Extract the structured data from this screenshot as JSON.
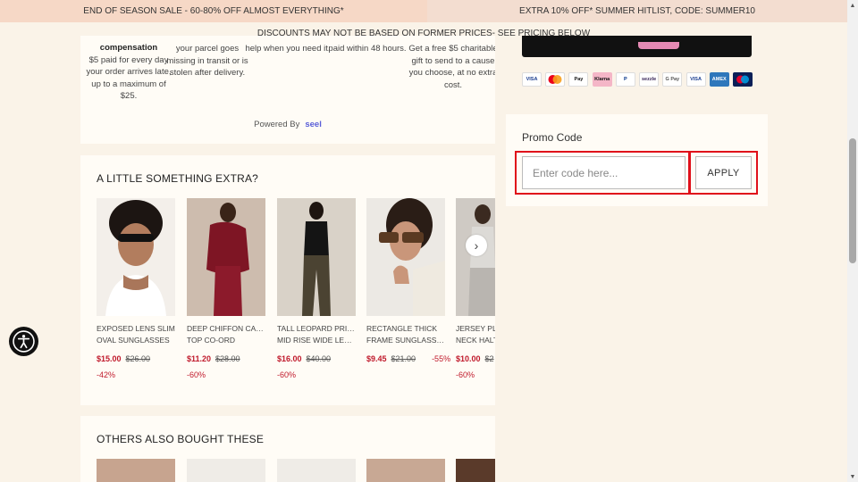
{
  "banner": {
    "left_text": "END OF SEASON SALE - 60-80% OFF ALMOST EVERYTHING*",
    "right_text": "EXTRA 10% OFF* SUMMER HITLIST, CODE: SUMMER10",
    "disclaimer": "DISCOUNTS MAY NOT BE BASED ON FORMER PRICES- SEE PRICING BELOW"
  },
  "benefits": [
    {
      "title": "compensation",
      "text": "$5 paid for every day your order arrives late, up to a maximum of $25."
    },
    {
      "title": "",
      "text": "your parcel goes missing in transit or is stolen after delivery."
    },
    {
      "title": "",
      "text": "help when you need it."
    },
    {
      "title": "",
      "text": "paid within 48 hours."
    },
    {
      "title": "",
      "text": "Get a free $5 charitable gift to send to a cause you choose, at no extra cost."
    }
  ],
  "powered": {
    "label": "Powered By",
    "brand": "seel"
  },
  "extra_section": {
    "title": "A LITTLE SOMETHING EXTRA?",
    "products": [
      {
        "name_line1": "EXPOSED LENS SLIM",
        "name_line2": "OVAL SUNGLASSES",
        "price": "$15.00",
        "old_price": "$26.00",
        "discount": "-42%"
      },
      {
        "name_line1": "DEEP CHIFFON CAPE",
        "name_line2": "TOP CO-ORD",
        "price": "$11.20",
        "old_price": "$28.00",
        "discount": "-60%"
      },
      {
        "name_line1": "TALL LEOPARD PRINT",
        "name_line2": "MID RISE WIDE LEG...",
        "price": "$16.00",
        "old_price": "$40.00",
        "discount": "-60%"
      },
      {
        "name_line1": "RECTANGLE THICK",
        "name_line2": "FRAME SUNGLASSES",
        "price": "$9.45",
        "old_price": "$21.00",
        "discount": "-55%"
      },
      {
        "name_line1": "JERSEY PL",
        "name_line2": "NECK HALT",
        "price": "$10.00",
        "old_price": "$2",
        "discount": "-60%"
      }
    ],
    "next_icon": "chevron-right-icon"
  },
  "others_section": {
    "title": "OTHERS ALSO BOUGHT THESE"
  },
  "payment_icons": [
    "VISA",
    "MC",
    "Pay",
    "Klarna",
    "P",
    "sezzle",
    "G Pay",
    "VISA",
    "AMEX",
    "Maestro"
  ],
  "promo": {
    "label": "Promo Code",
    "placeholder": "Enter code here...",
    "apply_label": "APPLY"
  },
  "colors": {
    "accent_red": "#c0192b",
    "highlight": "#e0101a",
    "background": "#faf3e8"
  }
}
